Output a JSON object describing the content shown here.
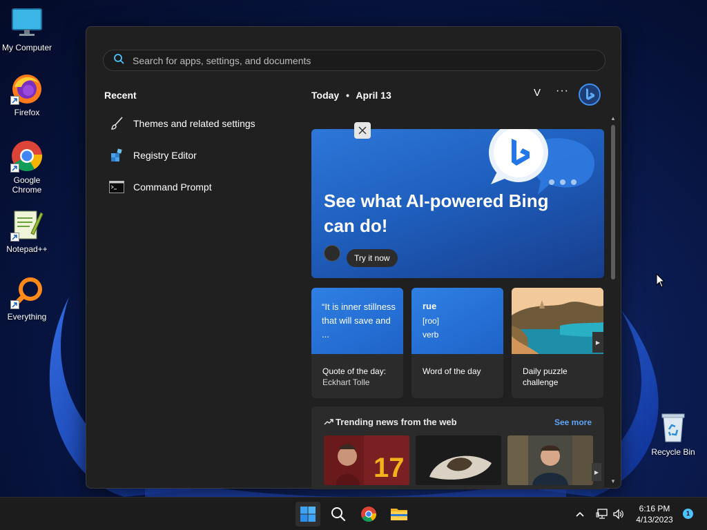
{
  "desktop": {
    "icons": [
      {
        "label": "My Computer"
      },
      {
        "label": "Firefox"
      },
      {
        "label": "Google Chrome"
      },
      {
        "label": "Notepad++"
      },
      {
        "label": "Everything"
      },
      {
        "label": "Recycle Bin"
      }
    ]
  },
  "start_menu": {
    "search": {
      "placeholder": "Search for apps, settings, and documents"
    },
    "recent": {
      "title": "Recent",
      "items": [
        {
          "label": "Themes and related settings",
          "icon": "brush-icon"
        },
        {
          "label": "Registry Editor",
          "icon": "registry-icon"
        },
        {
          "label": "Command Prompt",
          "icon": "terminal-icon"
        }
      ]
    },
    "widgets": {
      "header": {
        "today": "Today",
        "separator": "•",
        "date": "April 13",
        "avatar_letter": "V",
        "more": "···"
      },
      "hero": {
        "title": "See what AI-powered Bing can do!",
        "button": "Try it now"
      },
      "cards": [
        {
          "top_text": "“It is inner stillness that will save and ...",
          "label": "Quote of the day:",
          "sub": "Eckhart Tolle"
        },
        {
          "word": "rue",
          "pron": "[roo]",
          "pos": "verb",
          "label": "Word of the day"
        },
        {
          "label": "Daily puzzle challenge"
        }
      ],
      "trending": {
        "title": "Trending news from the web",
        "see_more": "See more"
      }
    }
  },
  "taskbar": {
    "clock": {
      "time": "6:16 PM",
      "date": "4/13/2023"
    },
    "notification_count": "1"
  },
  "colors": {
    "accent": "#4cc2ff",
    "link": "#60a5f5",
    "hero_blue": "#1f5fbe",
    "menu_bg": "#202020"
  }
}
